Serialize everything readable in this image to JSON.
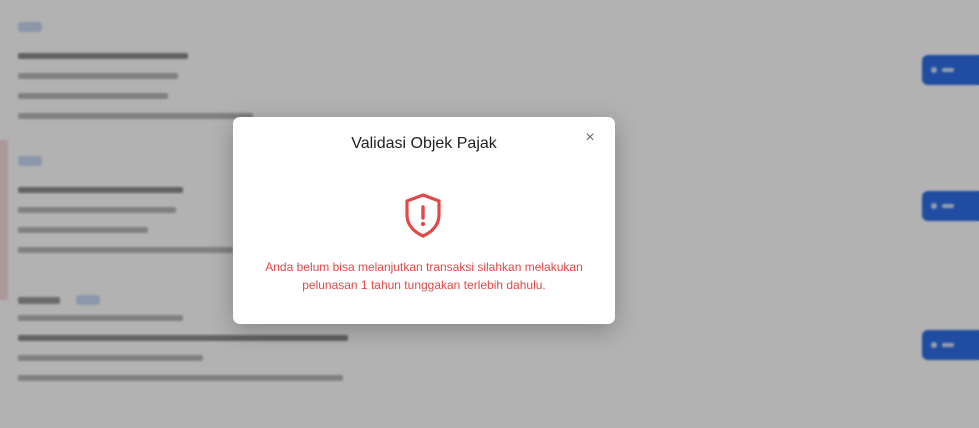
{
  "modal": {
    "title": "Validasi Objek Pajak",
    "close_symbol": "×",
    "icon": "shield-alert-icon",
    "message": "Anda belum bisa melanjutkan transaksi silahkan melakukan pelunasan 1 tahun tunggakan terlebih dahulu."
  },
  "colors": {
    "alert": "#e24848",
    "primary": "#2f6fe7",
    "overlay": "rgba(0,0,0,0.30)"
  }
}
